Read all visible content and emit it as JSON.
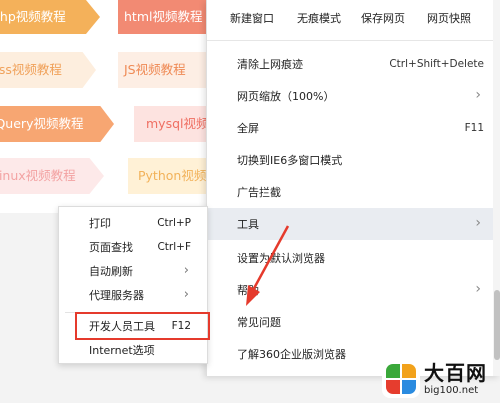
{
  "background_page": {
    "banners": [
      "php视频教程",
      "html视频教程",
      "css视频教程",
      "JS视频教程",
      "jQuery视频教程",
      "mysql视频",
      "Linux视频教程",
      "Python视频"
    ]
  },
  "main_menu": {
    "top_buttons": [
      "新建窗口",
      "无痕模式",
      "保存网页",
      "网页快照"
    ],
    "items": [
      {
        "label": "清除上网痕迹",
        "shortcut": "Ctrl+Shift+Delete"
      },
      {
        "label": "网页缩放（100%）",
        "shortcut": "",
        "arrow": "›"
      },
      {
        "label": "全屏",
        "shortcut": "F11"
      },
      {
        "label": "切换到IE6多窗口模式",
        "shortcut": ""
      },
      {
        "label": "广告拦截",
        "shortcut": ""
      },
      {
        "label": "工具",
        "shortcut": "",
        "arrow": "›"
      },
      {
        "label": "设置为默认浏览器",
        "shortcut": ""
      },
      {
        "label": "帮助",
        "shortcut": "",
        "arrow": "›"
      },
      {
        "label": "常见问题",
        "shortcut": ""
      },
      {
        "label": "了解360企业版浏览器",
        "shortcut": ""
      }
    ]
  },
  "sub_menu": {
    "items": [
      {
        "label": "打印",
        "shortcut": "Ctrl+P"
      },
      {
        "label": "页面查找",
        "shortcut": "Ctrl+F"
      },
      {
        "label": "自动刷新",
        "shortcut": "",
        "arrow": "›"
      },
      {
        "label": "代理服务器",
        "shortcut": "",
        "arrow": "›"
      },
      {
        "label": "开发人员工具",
        "shortcut": "F12"
      },
      {
        "label": "Internet选项",
        "shortcut": ""
      }
    ]
  },
  "watermark": {
    "title": "大百网",
    "url": "big100.net"
  },
  "colors": {
    "highlight": "#e53a2c",
    "menu_hover": "#e9ecf1"
  }
}
